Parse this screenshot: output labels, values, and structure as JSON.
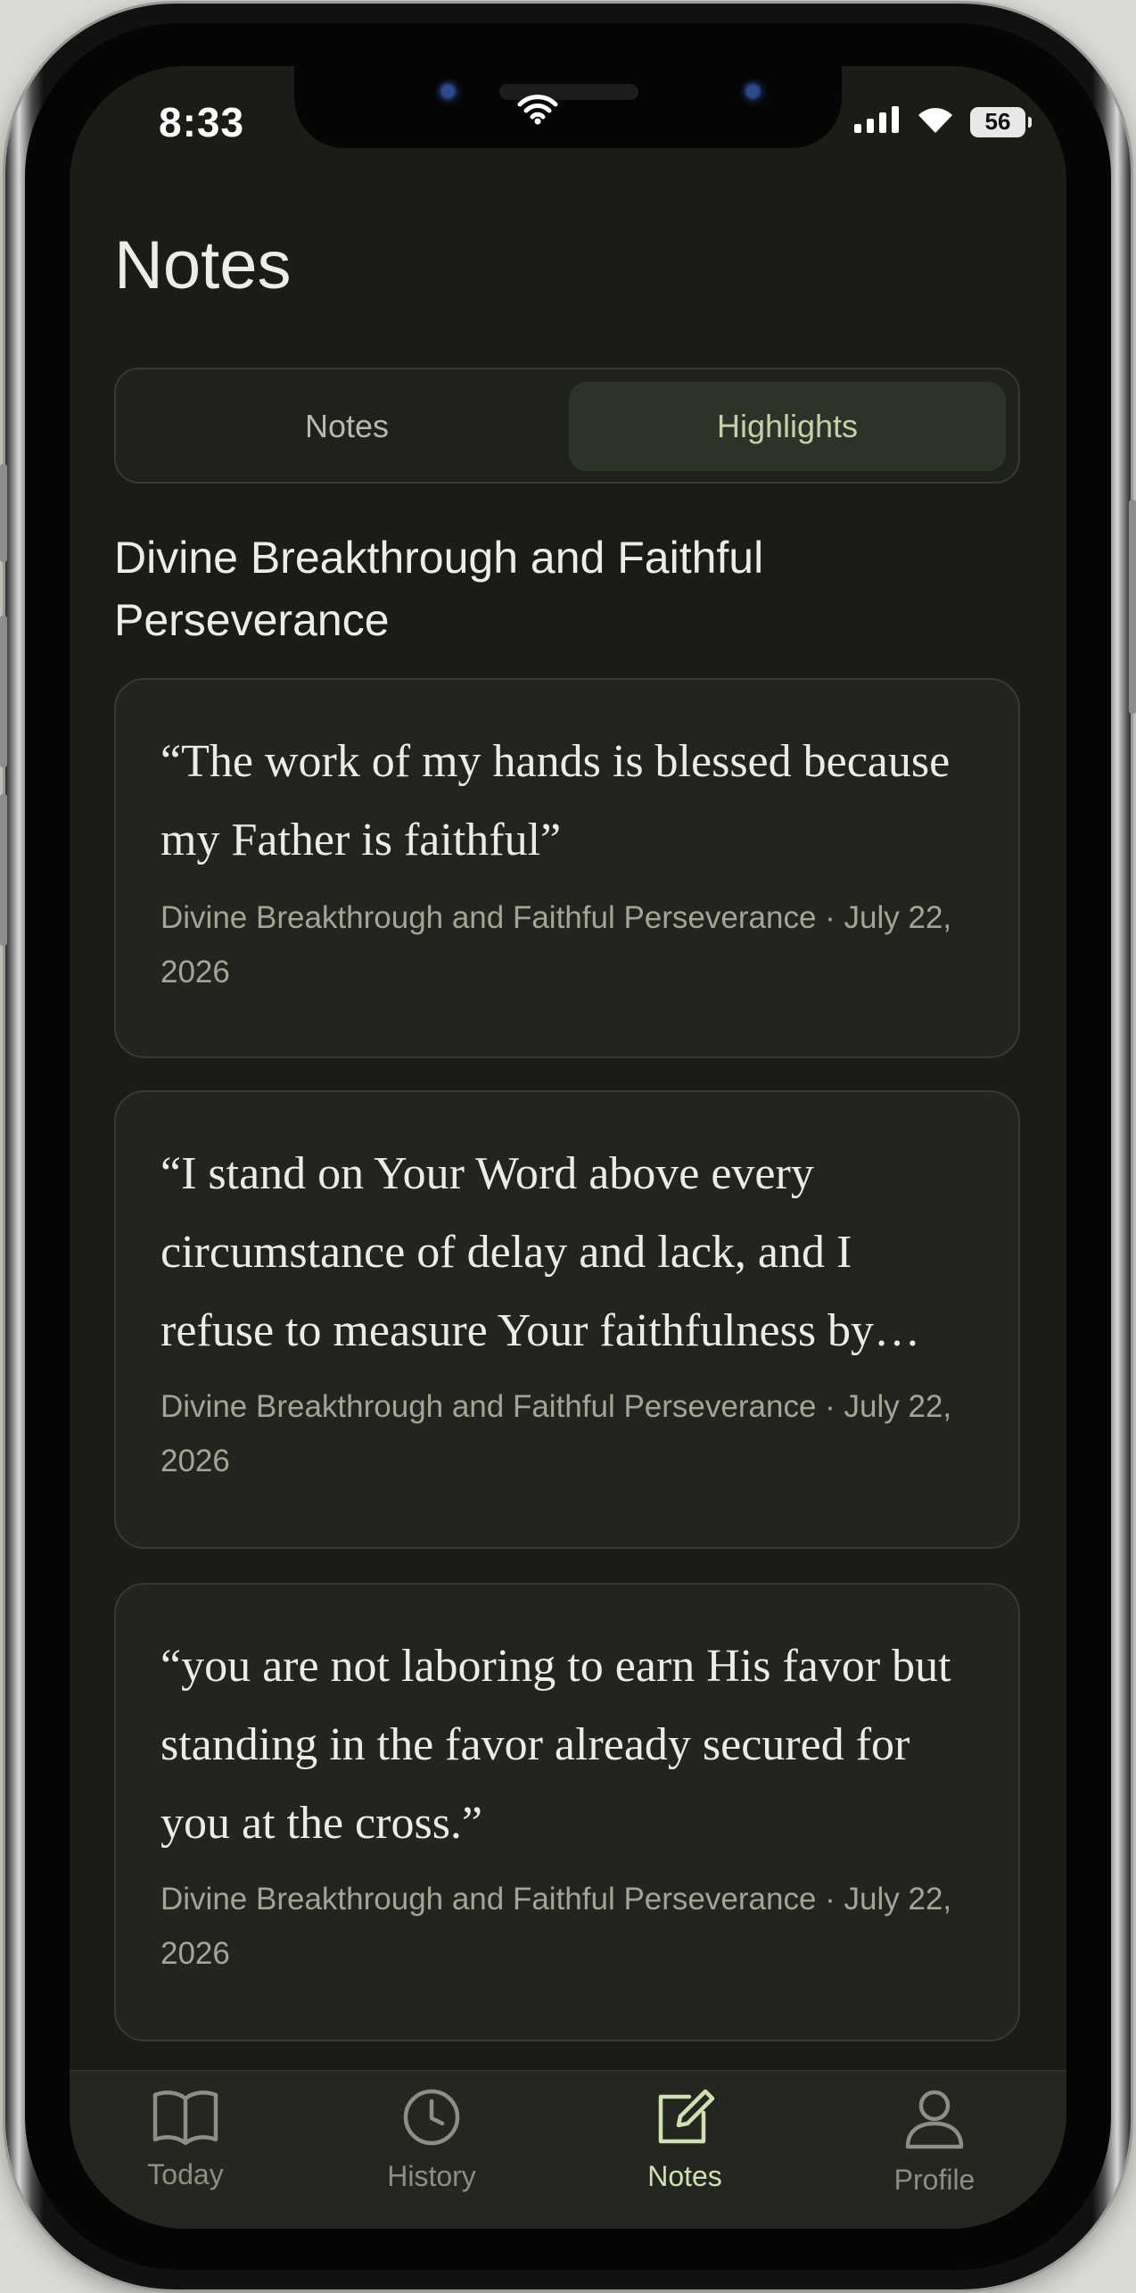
{
  "status_bar": {
    "time": "8:33",
    "battery": "56"
  },
  "page": {
    "title": "Notes"
  },
  "segmented_control": {
    "options": [
      {
        "label": "Notes",
        "selected": false
      },
      {
        "label": "Highlights",
        "selected": true
      }
    ]
  },
  "section": {
    "title": "Divine Breakthrough and Faithful Perseverance"
  },
  "highlights": [
    {
      "quote": "“The work of my hands is blessed because my Father is faithful”",
      "meta": "Divine Breakthrough and Faithful Perseverance · July 22, 2026"
    },
    {
      "quote": "“I stand on Your Word above every circumstance of delay and lack, and I refuse to measure Your faithfulness by…",
      "meta": "Divine Breakthrough and Faithful Perseverance · July 22, 2026"
    },
    {
      "quote": "“you are not laboring to earn His favor but standing in the favor already secured for you at the cross.”",
      "meta": "Divine Breakthrough and Faithful Perseverance · July 22, 2026"
    }
  ],
  "tab_bar": {
    "items": [
      {
        "label": "Today",
        "icon": "book-icon",
        "active": false
      },
      {
        "label": "History",
        "icon": "clock-icon",
        "active": false
      },
      {
        "label": "Notes",
        "icon": "compose-icon",
        "active": true
      },
      {
        "label": "Profile",
        "icon": "person-icon",
        "active": false
      }
    ]
  },
  "colors": {
    "background": "#1b1c18",
    "card": "#22241f",
    "accent": "#cfe0b4",
    "text": "#ececea",
    "muted": "#a3a596"
  }
}
